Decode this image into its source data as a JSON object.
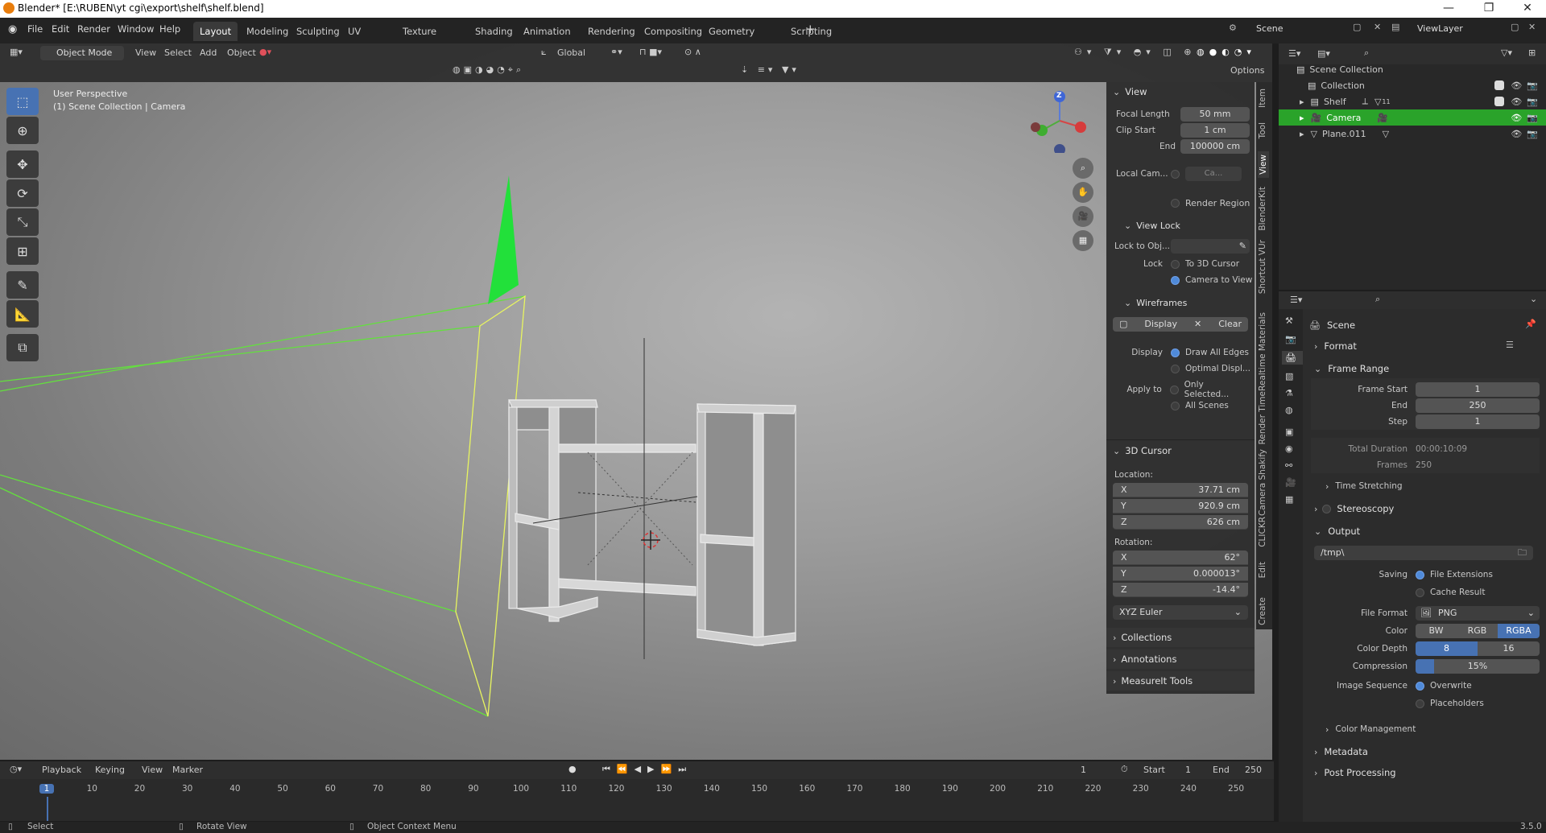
{
  "window": {
    "title": "Blender* [E:\\RUBEN\\yt cgi\\export\\shelf\\shelf.blend]",
    "controls": {
      "minimize": "—",
      "maximize": "❐",
      "close": "✕"
    }
  },
  "menu": {
    "file": "File",
    "edit": "Edit",
    "render": "Render",
    "window": "Window",
    "help": "Help"
  },
  "workspaces": [
    "Layout",
    "Modeling",
    "Sculpting",
    "UV Editing",
    "Texture Paint",
    "Shading",
    "Animation",
    "Rendering",
    "Compositing",
    "Geometry Nodes",
    "Scripting"
  ],
  "add_workspace": "+",
  "scene": {
    "label": "Scene",
    "view_layer": "ViewLayer"
  },
  "viewport_header": {
    "mode": "Object Mode",
    "view": "View",
    "select": "Select",
    "add": "Add",
    "object": "Object",
    "orientation": "Global",
    "options": "Options"
  },
  "viewport": {
    "perspective": "User Perspective",
    "collection_info": "(1) Scene Collection | Camera",
    "gizmo": {
      "z": "Z"
    }
  },
  "npanel": {
    "view_header": "View",
    "focal_length_label": "Focal Length",
    "focal_length": "50 mm",
    "clip_start_label": "Clip Start",
    "clip_start": "1 cm",
    "end_label": "End",
    "clip_end": "100000 cm",
    "local_cam_label": "Local Cam...",
    "local_cam_value": "Ca...",
    "render_region": "Render Region",
    "view_lock_header": "View Lock",
    "lock_to_obj": "Lock to Obj...",
    "lock_label": "Lock",
    "to_3d_cursor": "To 3D Cursor",
    "camera_to_view": "Camera to View",
    "wireframes_header": "Wireframes",
    "display_btn": "Display",
    "clear_btn": "Clear",
    "display_label": "Display",
    "draw_all_edges": "Draw All Edges",
    "optimal_display": "Optimal Displ...",
    "apply_to_label": "Apply to",
    "only_selected": "Only Selected...",
    "all_scenes": "All Scenes",
    "cursor_header": "3D Cursor",
    "location_label": "Location:",
    "loc": [
      {
        "axis": "X",
        "value": "37.71 cm"
      },
      {
        "axis": "Y",
        "value": "920.9 cm"
      },
      {
        "axis": "Z",
        "value": "626 cm"
      }
    ],
    "rotation_label": "Rotation:",
    "rot": [
      {
        "axis": "X",
        "value": "62°"
      },
      {
        "axis": "Y",
        "value": "0.000013°"
      },
      {
        "axis": "Z",
        "value": "-14.4°"
      }
    ],
    "rotation_mode": "XYZ Euler",
    "collections": "Collections",
    "annotations": "Annotations",
    "measureit": "MeasureIt Tools"
  },
  "ntabs": [
    "Item",
    "Tool",
    "View",
    "BlenderKit",
    "Shortcut VUr",
    "Realtime Materials",
    "Render Time",
    "Camera Shakify",
    "CLICKR",
    "Edit",
    "Create"
  ],
  "outliner": {
    "rows": [
      {
        "name": "Scene Collection",
        "indent": 0
      },
      {
        "name": "Collection",
        "indent": 1
      },
      {
        "name": "Shelf",
        "indent": 1
      },
      {
        "name": "Camera",
        "indent": 1
      },
      {
        "name": "Plane.011",
        "indent": 1
      }
    ],
    "shelf_badge": "11"
  },
  "properties": {
    "scene_label": "Scene",
    "format": "Format",
    "frame_range": "Frame Range",
    "frame_start_label": "Frame Start",
    "frame_start": "1",
    "end_label": "End",
    "frame_end": "250",
    "step_label": "Step",
    "step": "1",
    "total_duration_label": "Total Duration",
    "total_duration": "00:00:10:09",
    "frames_label": "Frames",
    "frames": "250",
    "time_stretching": "Time Stretching",
    "stereoscopy": "Stereoscopy",
    "output": "Output",
    "output_path": "/tmp\\",
    "saving_label": "Saving",
    "file_extensions": "File Extensions",
    "cache_result": "Cache Result",
    "file_format_label": "File Format",
    "file_format": "PNG",
    "color_label": "Color",
    "color_opts": [
      "BW",
      "RGB",
      "RGBA"
    ],
    "color_depth_label": "Color Depth",
    "depth_opts": [
      "8",
      "16"
    ],
    "compression_label": "Compression",
    "compression": "15%",
    "image_sequence_label": "Image Sequence",
    "overwrite": "Overwrite",
    "placeholders": "Placeholders",
    "color_management": "Color Management",
    "metadata": "Metadata",
    "post_processing": "Post Processing"
  },
  "timeline": {
    "playback": "Playback",
    "keying": "Keying",
    "view": "View",
    "marker": "Marker",
    "current_frame": "1",
    "start_label": "Start",
    "start": "1",
    "end_label": "End",
    "end": "250",
    "ticks": [
      "1",
      "10",
      "20",
      "30",
      "40",
      "50",
      "60",
      "70",
      "80",
      "90",
      "100",
      "110",
      "120",
      "130",
      "140",
      "150",
      "160",
      "170",
      "180",
      "190",
      "200",
      "210",
      "220",
      "230",
      "240",
      "250"
    ]
  },
  "status": {
    "select": "Select",
    "rotate": "Rotate View",
    "context": "Object Context Menu",
    "version": "3.5.0"
  }
}
